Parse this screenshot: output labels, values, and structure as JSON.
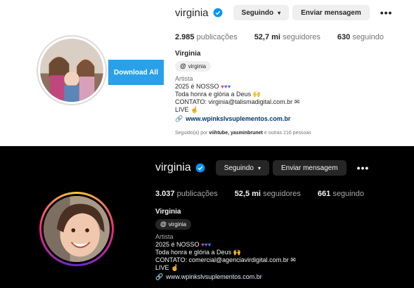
{
  "light": {
    "username": "virginia",
    "follow_button": "Seguindo",
    "message_button": "Enviar mensagem",
    "download_button": "Download All",
    "stats": [
      {
        "value": "2.985",
        "label": "publicações"
      },
      {
        "value": "52,7 mi",
        "label": "seguidores"
      },
      {
        "value": "630",
        "label": "seguindo"
      }
    ],
    "name": "Virginia",
    "threads_handle": "virginia",
    "category": "Artista",
    "bio_line1": "2025 é NOSSO",
    "bio_line2": "Toda honra e glória a Deus",
    "bio_line3": "CONTATO: virginia@talismadigital.com.br",
    "bio_line4": "LIVE",
    "link": "www.wpinkslvsuplementos.com.br",
    "followed_prefix": "Seguido(a) por",
    "followed_names": "viihtube, yasminbrunet",
    "followed_suffix": "e outras 216 pessoas"
  },
  "dark": {
    "username": "virginia",
    "follow_button": "Seguindo",
    "message_button": "Enviar mensagem",
    "stats": [
      {
        "value": "3.037",
        "label": "publicações"
      },
      {
        "value": "52,5 mi",
        "label": "seguidores"
      },
      {
        "value": "661",
        "label": "seguindo"
      }
    ],
    "name": "Virginia",
    "threads_handle": "virginia",
    "category": "Artista",
    "bio_line1": "2025 é NOSSO",
    "bio_line2": "Toda honra e glória a Deus",
    "bio_line3": "CONTATO: comercial@agenciavirdigital.com.br",
    "bio_line4": "LIVE",
    "link": "www.wpinkslvsuplementos.com.br"
  },
  "icons": {
    "verified": "verified-badge-icon",
    "more": "more-options-icon",
    "threads": "threads-icon",
    "link": "link-icon"
  }
}
